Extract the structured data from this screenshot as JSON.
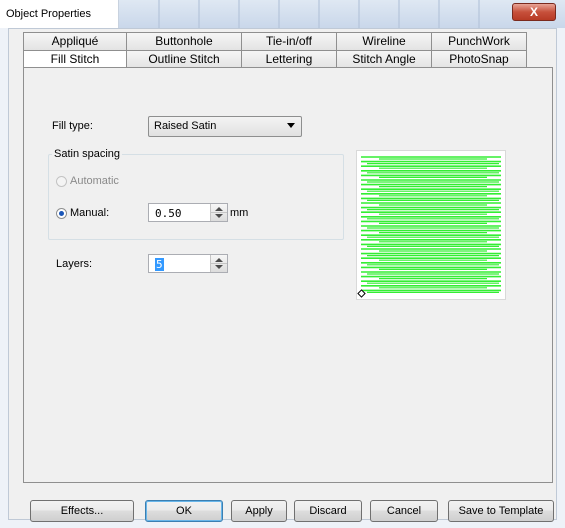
{
  "window": {
    "title": "Object Properties",
    "close_glyph": "X"
  },
  "tabs": {
    "top": [
      {
        "label": "Appliqué"
      },
      {
        "label": "Buttonhole"
      },
      {
        "label": "Tie-in/off"
      },
      {
        "label": "Wireline"
      },
      {
        "label": "PunchWork"
      }
    ],
    "bottom": [
      {
        "label": "Fill Stitch",
        "active": true
      },
      {
        "label": "Outline Stitch"
      },
      {
        "label": "Lettering"
      },
      {
        "label": "Stitch Angle"
      },
      {
        "label": "PhotoSnap"
      }
    ]
  },
  "fill_type": {
    "label": "Fill type:",
    "value": "Raised Satin"
  },
  "satin_spacing": {
    "title": "Satin spacing",
    "automatic_label": "Automatic",
    "manual_label": "Manual:",
    "manual_value": "0.50",
    "unit": "mm",
    "selected": "Manual"
  },
  "layers": {
    "label": "Layers:",
    "value": "5"
  },
  "preview": {
    "stitch_color": "#33ee33",
    "anchor_icon": "start-point-icon"
  },
  "buttons": {
    "effects": "Effects...",
    "ok": "OK",
    "apply": "Apply",
    "discard": "Discard",
    "cancel": "Cancel",
    "save_template": "Save to Template"
  }
}
